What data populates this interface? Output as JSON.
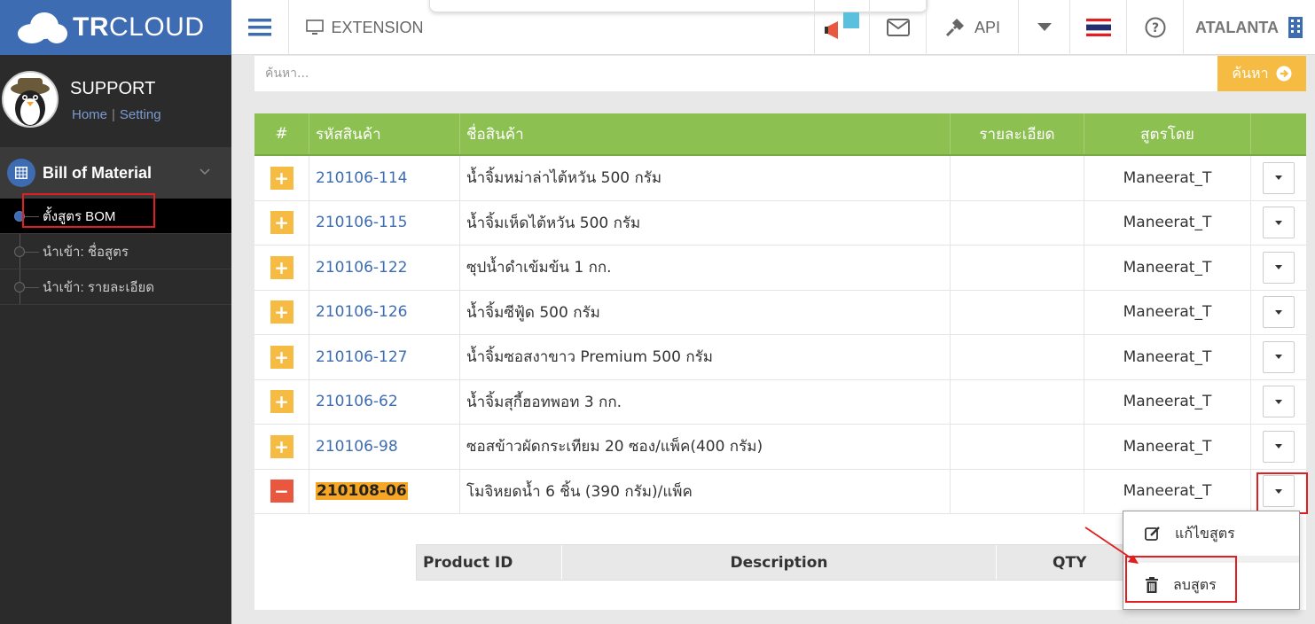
{
  "header": {
    "logo_text_bold": "TR",
    "logo_text": "CLOUD",
    "extension_label": "EXTENSION",
    "api_label": "API",
    "user_name": "ATALANTA"
  },
  "sidebar": {
    "profile_name": "SUPPORT",
    "home_link": "Home",
    "separator": "|",
    "setting_link": "Setting",
    "menu_title": "Bill of Material",
    "items": [
      {
        "label": "ตั้งสูตร BOM"
      },
      {
        "label": "นำเข้า: ชื่อสูตร"
      },
      {
        "label": "นำเข้า: รายละเอียด"
      }
    ]
  },
  "search": {
    "placeholder": "ค้นหา...",
    "button_label": "ค้นหา"
  },
  "table": {
    "headers": [
      "#",
      "รหัสสินค้า",
      "ชื่อสินค้า",
      "รายละเอียด",
      "สูตรโดย",
      ""
    ],
    "rows": [
      {
        "code": "210106-114",
        "name": "น้ำจิ้มหม่าล่าไต้หวัน 500 กรัม",
        "detail": "",
        "by": "Maneerat_T",
        "expand": "+"
      },
      {
        "code": "210106-115",
        "name": "น้ำจิ้มเห็ดไต้หวัน 500 กรัม",
        "detail": "",
        "by": "Maneerat_T",
        "expand": "+"
      },
      {
        "code": "210106-122",
        "name": "ซุปน้ำดำเข้มข้น 1 กก.",
        "detail": "",
        "by": "Maneerat_T",
        "expand": "+"
      },
      {
        "code": "210106-126",
        "name": "น้ำจิ้มซีฟู้ด 500 กรัม",
        "detail": "",
        "by": "Maneerat_T",
        "expand": "+"
      },
      {
        "code": "210106-127",
        "name": "น้ำจิ้มซอสงาขาว Premium 500 กรัม",
        "detail": "",
        "by": "Maneerat_T",
        "expand": "+"
      },
      {
        "code": "210106-62",
        "name": "น้ำจิ้มสุกี้ฮอทพอท 3 กก.",
        "detail": "",
        "by": "Maneerat_T",
        "expand": "+"
      },
      {
        "code": "210106-98",
        "name": "ซอสข้าวผัดกระเทียม 20 ซอง/แพ็ค(400 กรัม)",
        "detail": "",
        "by": "Maneerat_T",
        "expand": "+"
      },
      {
        "code": "210108-06",
        "name": "โมจิหยดน้ำ 6 ชิ้น (390 กรัม)/แพ็ค",
        "detail": "",
        "by": "Maneerat_T",
        "expand": "−"
      }
    ],
    "sub_headers": [
      "Product ID",
      "Description",
      "QTY"
    ]
  },
  "dropdown": {
    "edit_label": "แก้ไขสูตร",
    "delete_label": "ลบสูตร"
  },
  "colors": {
    "brand": "#3d6cb3",
    "table_header": "#8cc152",
    "accent": "#f6bb42",
    "danger": "#e9573f",
    "annotation": "#e02020"
  }
}
